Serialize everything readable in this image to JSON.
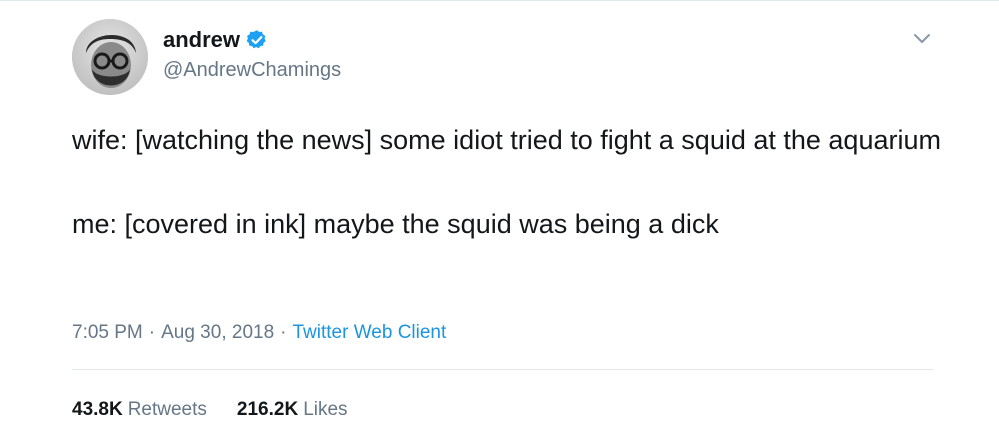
{
  "author": {
    "display_name": "andrew",
    "handle": "@AndrewChamings",
    "verified": true
  },
  "tweet": {
    "line1": "wife: [watching the news] some idiot tried to fight a squid at the aquarium",
    "line2": "me: [covered in ink] maybe the squid was being a dick"
  },
  "meta": {
    "time": "7:05 PM",
    "separator": "·",
    "date": "Aug 30, 2018",
    "source": "Twitter Web Client"
  },
  "stats": {
    "retweets_count": "43.8K",
    "retweets_label": "Retweets",
    "likes_count": "216.2K",
    "likes_label": "Likes"
  },
  "icons": {
    "verified": "verified-badge-icon",
    "menu": "chevron-down-icon"
  },
  "colors": {
    "text": "#14171a",
    "secondary": "#657786",
    "link": "#1b95e0",
    "verified": "#1da1f2",
    "divider": "#e1e8ed"
  }
}
